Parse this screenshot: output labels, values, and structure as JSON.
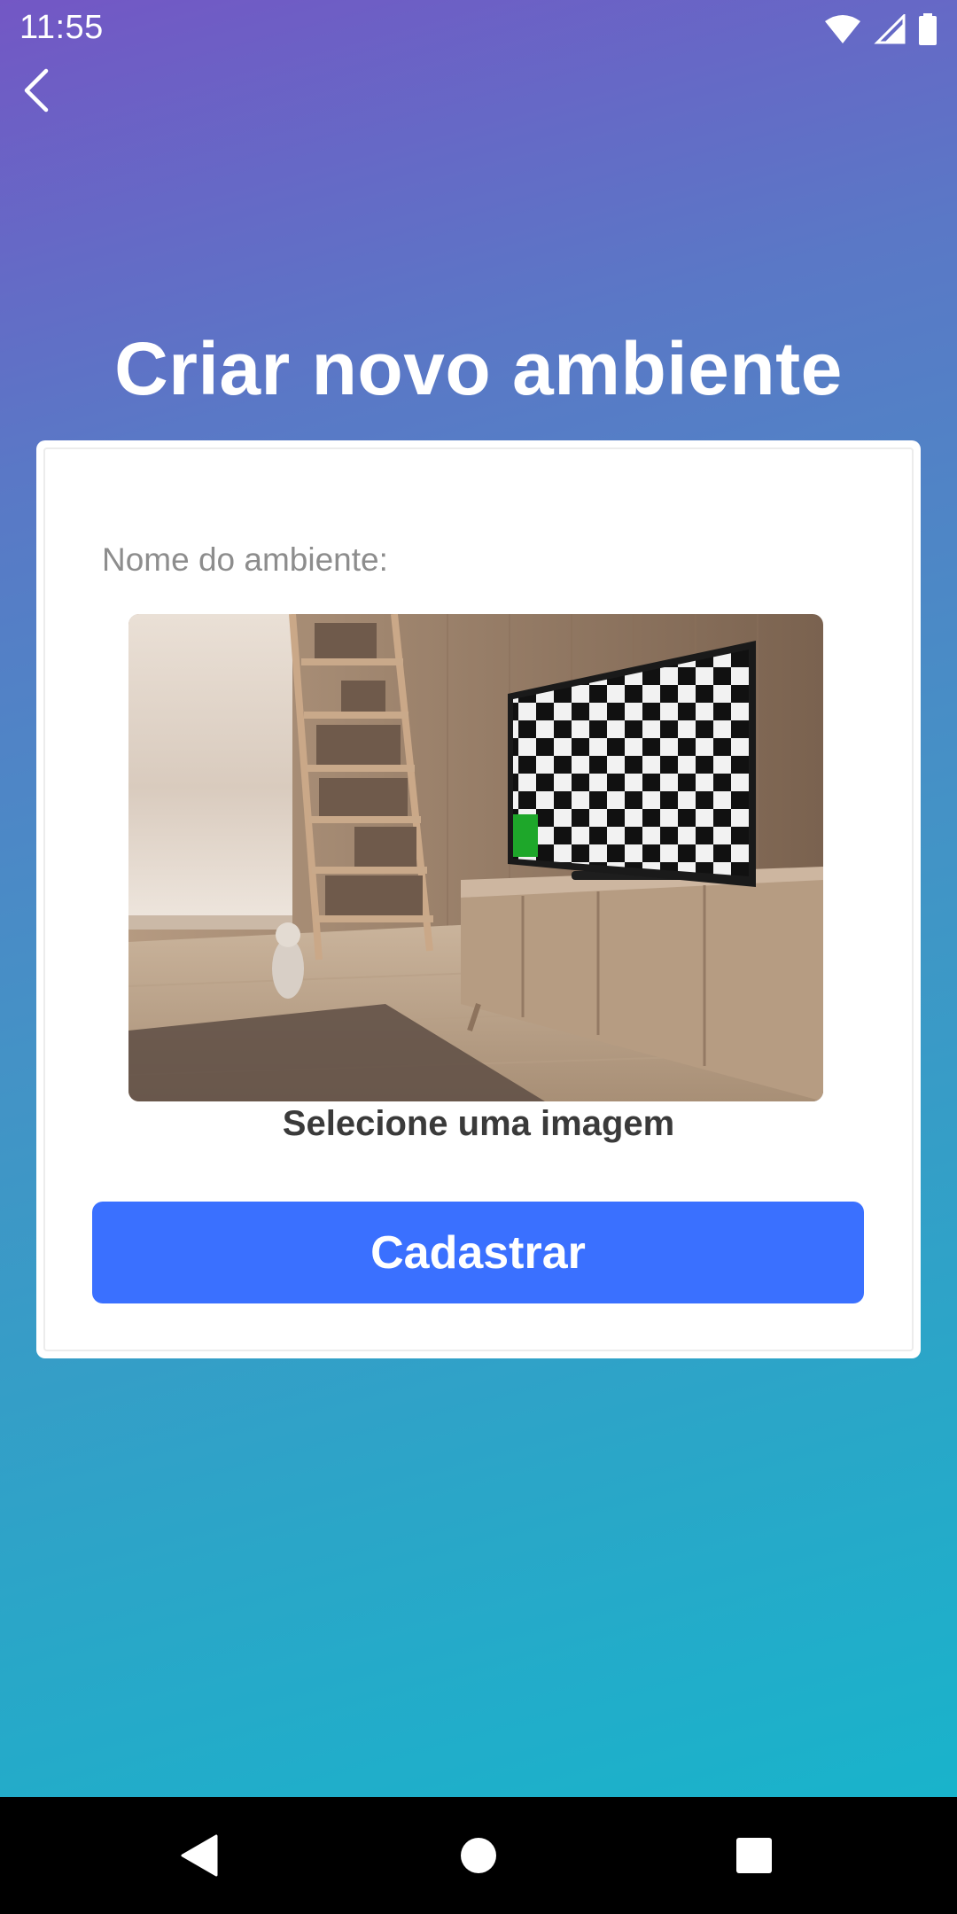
{
  "status_bar": {
    "time": "11:55",
    "icons": [
      "wifi-icon",
      "cell-signal-icon",
      "battery-icon"
    ]
  },
  "header": {
    "back_icon": "chevron-left-icon"
  },
  "main": {
    "title": "Criar novo ambiente",
    "name_field": {
      "placeholder": "Nome do ambiente:",
      "value": ""
    },
    "image_picker": {
      "label": "Selecione uma imagem",
      "preview": "room with bookshelf, cat, and TV showing checkerboard"
    },
    "submit_label": "Cadastrar"
  },
  "nav_bar": {
    "buttons": [
      "back-triangle-icon",
      "home-circle-icon",
      "recents-square-icon"
    ]
  },
  "colors": {
    "gradient_top": "#7357c5",
    "gradient_bottom": "#14b7cc",
    "button": "#3a70ff",
    "card": "#ffffff"
  }
}
